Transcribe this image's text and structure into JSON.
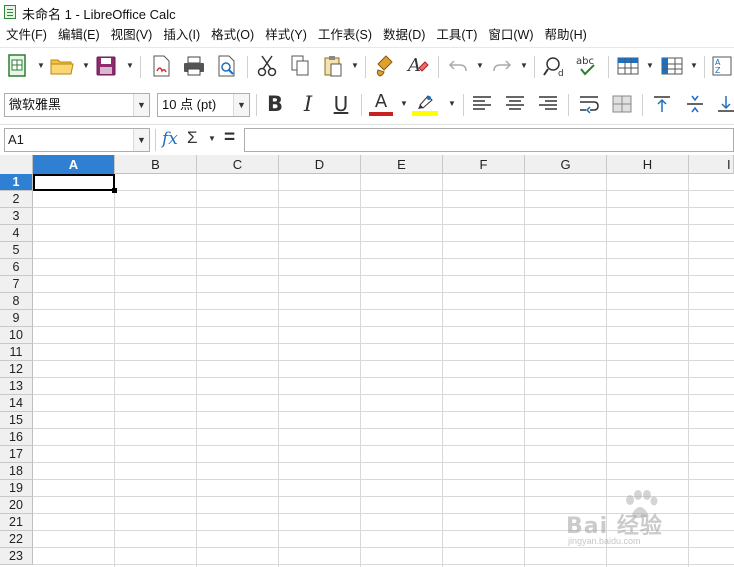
{
  "window": {
    "title": "未命名 1 - LibreOffice Calc"
  },
  "menu": {
    "items": [
      {
        "label": "文件(F)"
      },
      {
        "label": "编辑(E)"
      },
      {
        "label": "视图(V)"
      },
      {
        "label": "插入(I)"
      },
      {
        "label": "格式(O)"
      },
      {
        "label": "样式(Y)"
      },
      {
        "label": "工作表(S)"
      },
      {
        "label": "数据(D)"
      },
      {
        "label": "工具(T)"
      },
      {
        "label": "窗口(W)"
      },
      {
        "label": "帮助(H)"
      }
    ]
  },
  "toolbar_standard": {
    "icons": [
      "new-spreadsheet-icon",
      "open-folder-icon",
      "save-icon",
      "export-pdf-icon",
      "print-icon",
      "print-preview-icon",
      "cut-icon",
      "copy-icon",
      "paste-icon",
      "clone-formatting-icon",
      "clear-formatting-icon",
      "undo-icon",
      "redo-icon",
      "find-replace-icon",
      "spelling-icon",
      "row-icon",
      "column-icon",
      "sort-icon"
    ]
  },
  "toolbar_format": {
    "font_name": "微软雅黑",
    "font_size": "10 点 (pt)",
    "bold": "B",
    "italic": "I",
    "underline": "U",
    "font_color_glyph": "A",
    "font_color": "#c9211e",
    "highlight_color": "#ffff00"
  },
  "formula_bar": {
    "name_box": "A1",
    "function_wizard": "fx",
    "sum_glyph": "Σ",
    "equals_glyph": "=",
    "formula": ""
  },
  "sheet": {
    "columns": [
      "A",
      "B",
      "C",
      "D",
      "E",
      "F",
      "G",
      "H",
      "I"
    ],
    "rows": [
      "1",
      "2",
      "3",
      "4",
      "5",
      "6",
      "7",
      "8",
      "9",
      "10",
      "11",
      "12",
      "13",
      "14",
      "15",
      "16",
      "17",
      "18",
      "19",
      "20",
      "21",
      "22",
      "23"
    ],
    "active_cell": "A1",
    "selection_color": "#2f7fd2"
  },
  "watermark": {
    "text": "Bai 经验",
    "sub": "jingyan.baidu.com"
  }
}
